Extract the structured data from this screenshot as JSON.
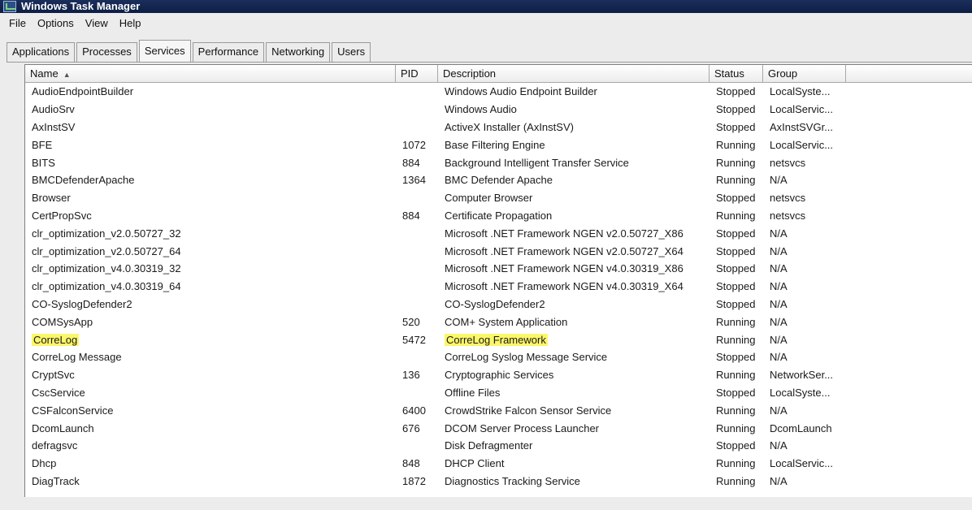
{
  "window": {
    "title": "Windows Task Manager"
  },
  "menu": [
    "File",
    "Options",
    "View",
    "Help"
  ],
  "tabs": [
    "Applications",
    "Processes",
    "Services",
    "Performance",
    "Networking",
    "Users"
  ],
  "active_tab": "Services",
  "columns": {
    "name": "Name",
    "pid": "PID",
    "description": "Description",
    "status": "Status",
    "group": "Group",
    "sort_indicator": "▲"
  },
  "highlight_color": "#fbf66a",
  "services": [
    {
      "name": "AudioEndpointBuilder",
      "pid": "",
      "description": "Windows Audio Endpoint Builder",
      "status": "Stopped",
      "group": "LocalSyste..."
    },
    {
      "name": "AudioSrv",
      "pid": "",
      "description": "Windows Audio",
      "status": "Stopped",
      "group": "LocalServic..."
    },
    {
      "name": "AxInstSV",
      "pid": "",
      "description": "ActiveX Installer (AxInstSV)",
      "status": "Stopped",
      "group": "AxInstSVGr..."
    },
    {
      "name": "BFE",
      "pid": "1072",
      "description": "Base Filtering Engine",
      "status": "Running",
      "group": "LocalServic..."
    },
    {
      "name": "BITS",
      "pid": "884",
      "description": "Background Intelligent Transfer Service",
      "status": "Running",
      "group": "netsvcs"
    },
    {
      "name": "BMCDefenderApache",
      "pid": "1364",
      "description": "BMC Defender Apache",
      "status": "Running",
      "group": "N/A"
    },
    {
      "name": "Browser",
      "pid": "",
      "description": "Computer Browser",
      "status": "Stopped",
      "group": "netsvcs"
    },
    {
      "name": "CertPropSvc",
      "pid": "884",
      "description": "Certificate Propagation",
      "status": "Running",
      "group": "netsvcs"
    },
    {
      "name": "clr_optimization_v2.0.50727_32",
      "pid": "",
      "description": "Microsoft .NET Framework NGEN v2.0.50727_X86",
      "status": "Stopped",
      "group": "N/A"
    },
    {
      "name": "clr_optimization_v2.0.50727_64",
      "pid": "",
      "description": "Microsoft .NET Framework NGEN v2.0.50727_X64",
      "status": "Stopped",
      "group": "N/A"
    },
    {
      "name": "clr_optimization_v4.0.30319_32",
      "pid": "",
      "description": "Microsoft .NET Framework NGEN v4.0.30319_X86",
      "status": "Stopped",
      "group": "N/A"
    },
    {
      "name": "clr_optimization_v4.0.30319_64",
      "pid": "",
      "description": "Microsoft .NET Framework NGEN v4.0.30319_X64",
      "status": "Stopped",
      "group": "N/A"
    },
    {
      "name": "CO-SyslogDefender2",
      "pid": "",
      "description": "CO-SyslogDefender2",
      "status": "Stopped",
      "group": "N/A"
    },
    {
      "name": "COMSysApp",
      "pid": "520",
      "description": "COM+ System Application",
      "status": "Running",
      "group": "N/A"
    },
    {
      "name": "CorreLog",
      "pid": "5472",
      "description": "CorreLog Framework",
      "status": "Running",
      "group": "N/A",
      "highlighted": true
    },
    {
      "name": "CorreLog Message",
      "pid": "",
      "description": "CorreLog Syslog Message Service",
      "status": "Stopped",
      "group": "N/A"
    },
    {
      "name": "CryptSvc",
      "pid": "136",
      "description": "Cryptographic Services",
      "status": "Running",
      "group": "NetworkSer..."
    },
    {
      "name": "CscService",
      "pid": "",
      "description": "Offline Files",
      "status": "Stopped",
      "group": "LocalSyste..."
    },
    {
      "name": "CSFalconService",
      "pid": "6400",
      "description": "CrowdStrike Falcon Sensor Service",
      "status": "Running",
      "group": "N/A"
    },
    {
      "name": "DcomLaunch",
      "pid": "676",
      "description": "DCOM Server Process Launcher",
      "status": "Running",
      "group": "DcomLaunch"
    },
    {
      "name": "defragsvc",
      "pid": "",
      "description": "Disk Defragmenter",
      "status": "Stopped",
      "group": "N/A"
    },
    {
      "name": "Dhcp",
      "pid": "848",
      "description": "DHCP Client",
      "status": "Running",
      "group": "LocalServic..."
    },
    {
      "name": "DiagTrack",
      "pid": "1872",
      "description": "Diagnostics Tracking Service",
      "status": "Running",
      "group": "N/A"
    }
  ]
}
